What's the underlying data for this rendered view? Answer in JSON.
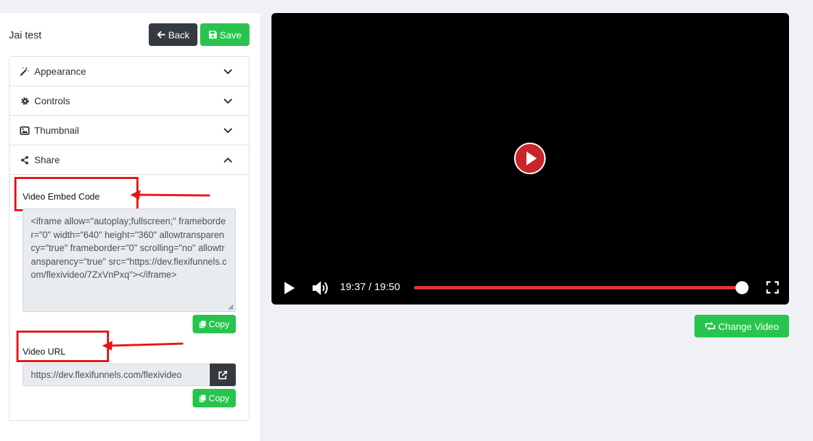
{
  "header": {
    "title": "Jai test",
    "back_label": "Back",
    "save_label": "Save"
  },
  "accordion": {
    "items": [
      {
        "label": "Appearance",
        "icon": "magic-wand-icon",
        "expanded": false
      },
      {
        "label": "Controls",
        "icon": "gear-icon",
        "expanded": false
      },
      {
        "label": "Thumbnail",
        "icon": "image-icon",
        "expanded": false
      },
      {
        "label": "Share",
        "icon": "share-icon",
        "expanded": true
      }
    ]
  },
  "share": {
    "embed_label": "Video Embed Code",
    "embed_code": "<iframe allow=\"autoplay;fullscreen;\" frameborder=\"0\" width=\"640\" height=\"360\" allowtransparency=\"true\" frameborder=\"0\" scrolling=\"no\" allowtransparency=\"true\" src=\"https://dev.flexifunnels.com/flexivideo/7ZxVnPxq\"></iframe>",
    "copy_label": "Copy",
    "url_label": "Video URL",
    "url_value": "https://dev.flexifunnels.com/flexivideo",
    "open_icon": "external-link-icon"
  },
  "player": {
    "time_display": "19:37 / 19:50",
    "progress": 0.983
  },
  "change_video_label": "Change Video",
  "colors": {
    "green": "#28c44d",
    "dark": "#343a40",
    "annotation_red": "#e81416",
    "progress": "#e0383c",
    "play_button": "#c8262b"
  }
}
